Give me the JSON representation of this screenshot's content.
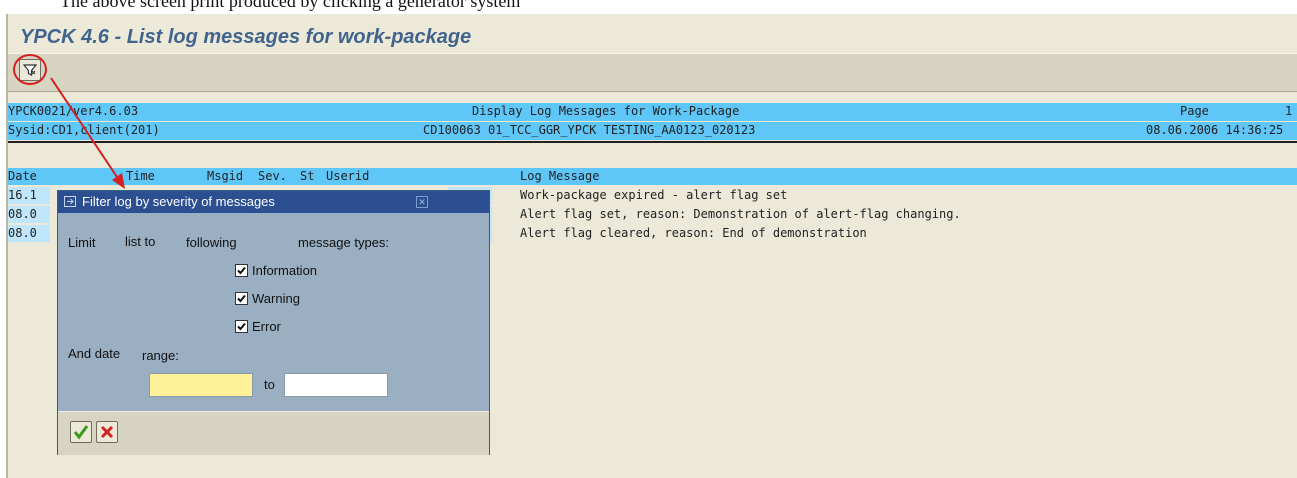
{
  "top_clipped_text": "The above screen print produced by clicking a generator system",
  "title": "YPCK 4.6 - List log messages for work-package",
  "toolbar": {
    "filter_icon": "filter-funnel-icon"
  },
  "report": {
    "header1": {
      "left": "YPCK0021/ver4.6.03",
      "center": "Display Log Messages for Work-Package",
      "right_label": "Page",
      "right_value": "1"
    },
    "header2": {
      "left": "Sysid:CD1,client(201)",
      "center": "CD100063 01_TCC_GGR_YPCK TESTING_AA0123_020123",
      "right": "08.06.2006 14:36:25"
    },
    "columns": {
      "date": "Date",
      "time": "Time",
      "msgid": "Msgid",
      "sev": "Sev.",
      "st": "St",
      "userid": "Userid",
      "message": "Log Message"
    },
    "rows": [
      {
        "date": "16.1",
        "message": "Work-package expired - alert flag set"
      },
      {
        "date": "08.0",
        "message": "Alert flag set, reason: Demonstration of alert-flag changing."
      },
      {
        "date": "08.0",
        "message": "Alert flag cleared, reason: End of demonstration"
      }
    ]
  },
  "dialog": {
    "title": "Filter log by severity of messages",
    "limit_words": [
      "Limit",
      "list to",
      "following",
      "message types:"
    ],
    "checkboxes": [
      {
        "label": "Information",
        "checked": true
      },
      {
        "label": "Warning",
        "checked": true
      },
      {
        "label": "Error",
        "checked": true
      }
    ],
    "date_words": [
      "And date",
      "range:"
    ],
    "to_label": "to",
    "from_value": "",
    "to_value": "",
    "ok_icon": "check-icon",
    "cancel_icon": "cancel-x-icon"
  },
  "colors": {
    "header_bar": "#5fc7f8",
    "dialog_title": "#2b4f91",
    "dialog_body": "#9ab0c2",
    "title_text": "#41648f",
    "annotation": "#d42020",
    "date_from_bg": "#fff19a"
  }
}
